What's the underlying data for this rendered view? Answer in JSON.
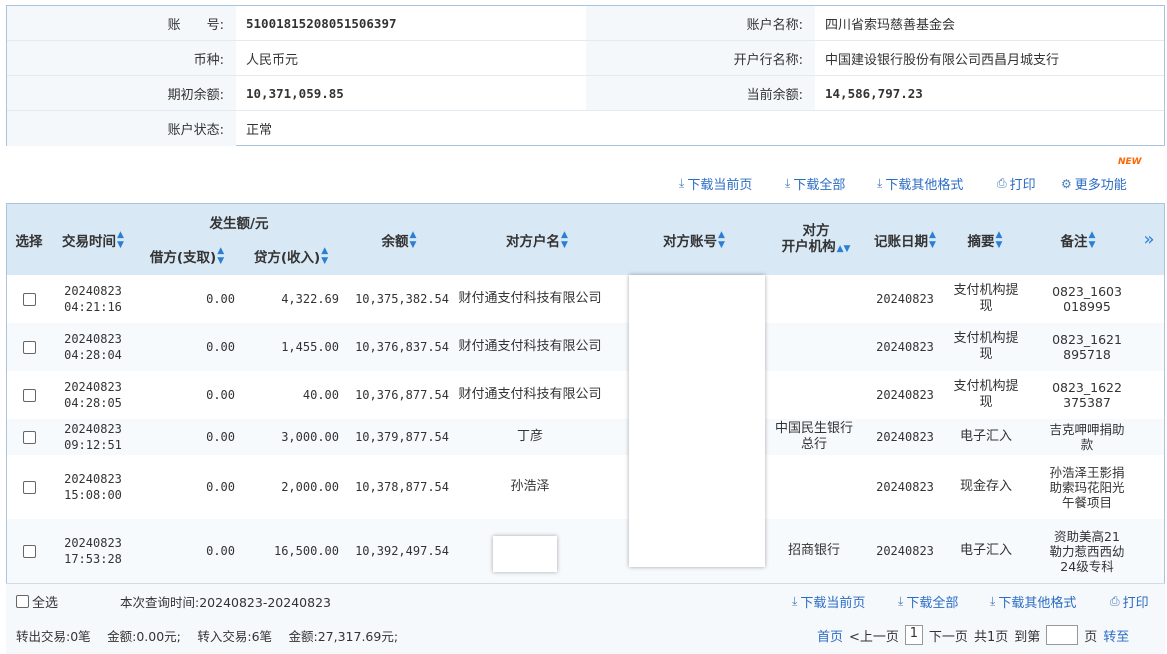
{
  "account": {
    "number_label": "账　　号:",
    "number": "51001815208051506397",
    "name_label": "账户名称:",
    "name": "四川省索玛慈善基金会",
    "currency_label": "币种:",
    "currency": "人民币元",
    "bank_label": "开户行名称:",
    "bank": "中国建设银行股份有限公司西昌月城支行",
    "opening_label": "期初余额:",
    "opening": "10,371,059.85",
    "current_label": "当前余额:",
    "current": "14,586,797.23",
    "status_label": "账户状态:",
    "status": "正常"
  },
  "toolbar": {
    "new_badge": "NEW",
    "download_page": "下载当前页",
    "download_all": "下载全部",
    "download_other": "下载其他格式",
    "print": "打印",
    "more": "更多功能"
  },
  "table": {
    "headers": {
      "select": "选择",
      "time": "交易时间",
      "amount_group": "发生额/元",
      "debit": "借方(支取)",
      "credit": "贷方(收入)",
      "balance": "余额",
      "party_name": "对方户名",
      "party_account": "对方账号",
      "party_bank_1": "对方",
      "party_bank_2": "开户机构",
      "post_date": "记账日期",
      "summary": "摘要",
      "note": "备注",
      "expand": "»"
    },
    "rows": [
      {
        "date": "20240823",
        "time": "04:21:16",
        "debit": "0.00",
        "credit": "4,322.69",
        "balance": "10,375,382.54",
        "party": "财付通支付科技有限公司",
        "bank": "",
        "post": "20240823",
        "summary": "支付机构提现",
        "note": "0823_1603018995"
      },
      {
        "date": "20240823",
        "time": "04:28:04",
        "debit": "0.00",
        "credit": "1,455.00",
        "balance": "10,376,837.54",
        "party": "财付通支付科技有限公司",
        "bank": "",
        "post": "20240823",
        "summary": "支付机构提现",
        "note": "0823_1621895718"
      },
      {
        "date": "20240823",
        "time": "04:28:05",
        "debit": "0.00",
        "credit": "40.00",
        "balance": "10,376,877.54",
        "party": "财付通支付科技有限公司",
        "bank": "",
        "post": "20240823",
        "summary": "支付机构提现",
        "note": "0823_1622375387"
      },
      {
        "date": "20240823",
        "time": "09:12:51",
        "debit": "0.00",
        "credit": "3,000.00",
        "balance": "10,379,877.54",
        "party": "丁彦",
        "bank": "中国民生银行总行",
        "post": "20240823",
        "summary": "电子汇入",
        "note": "吉克呷呷捐助款"
      },
      {
        "date": "20240823",
        "time": "15:08:00",
        "debit": "0.00",
        "credit": "2,000.00",
        "balance": "10,378,877.54",
        "party": "孙浩泽",
        "bank": "",
        "post": "20240823",
        "summary": "现金存入",
        "note": "孙浩泽王影捐助索玛花阳光午餐项目"
      },
      {
        "date": "20240823",
        "time": "17:53:28",
        "debit": "0.00",
        "credit": "16,500.00",
        "balance": "10,392,497.54",
        "party": "",
        "bank": "招商银行",
        "post": "20240823",
        "summary": "电子汇入",
        "note": "资助美高21勒力惹西西幼24级专科"
      }
    ]
  },
  "footer": {
    "select_all": "全选",
    "query_time": "本次查询时间:20240823-20240823",
    "download_page": "下载当前页",
    "download_all": "下载全部",
    "download_other": "下载其他格式",
    "print": "打印",
    "summary": "转出交易:0笔　 金额:0.00元;　 转入交易:6笔　 金额:27,317.69元;",
    "first": "首页",
    "prev": "<上一页",
    "page": "1",
    "next": "下一页",
    "total": "共1页",
    "goto": "到第",
    "page_unit": "页",
    "go": "转至"
  }
}
